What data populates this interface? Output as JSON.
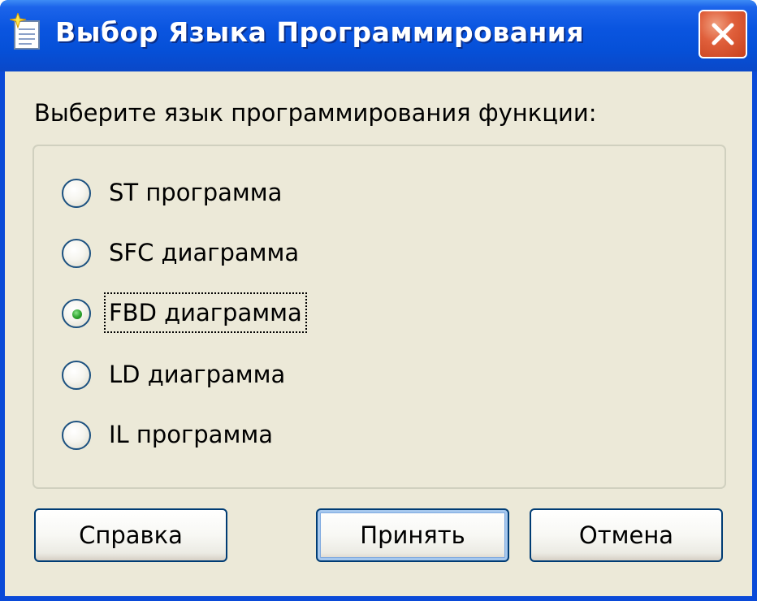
{
  "window": {
    "title": "Выбор Языка Программирования",
    "icon": "new-document-sparkle-icon",
    "close_icon": "close-icon"
  },
  "prompt": "Выберите язык программирования функции:",
  "options": [
    {
      "label": "ST программа",
      "selected": false
    },
    {
      "label": "SFC диаграмма",
      "selected": false
    },
    {
      "label": "FBD диаграмма",
      "selected": true
    },
    {
      "label": "LD диаграмма",
      "selected": false
    },
    {
      "label": "IL программа",
      "selected": false
    }
  ],
  "buttons": {
    "help": "Справка",
    "accept": "Принять",
    "cancel": "Отмена"
  },
  "colors": {
    "titlebar": "#0a55e0",
    "face": "#ece9d8",
    "close": "#e0603c",
    "radio_dot": "#2ba02b"
  }
}
